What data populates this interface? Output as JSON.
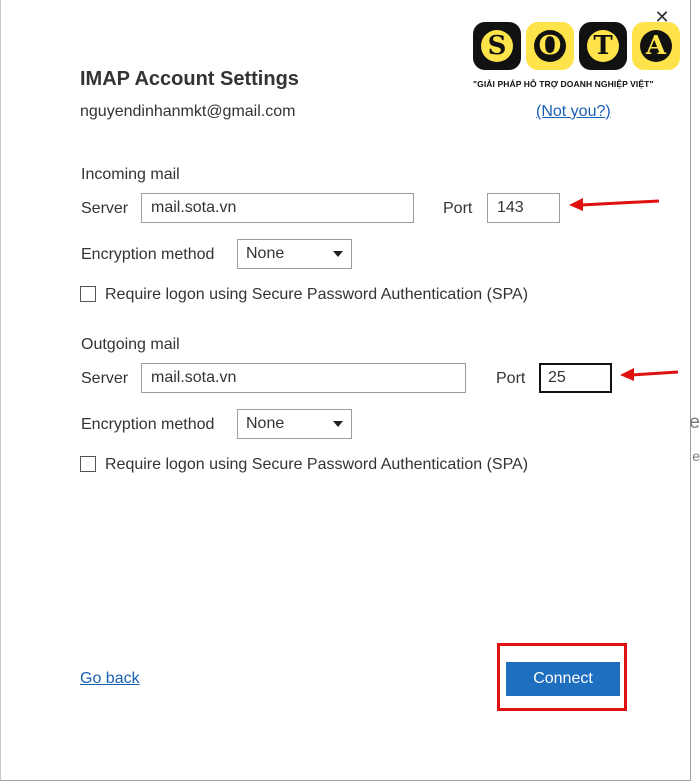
{
  "dialog": {
    "title": "IMAP Account Settings",
    "email": "nguyendinhanmkt@gmail.com",
    "not_you_link": "(Not you?)",
    "close_glyph": "✕"
  },
  "logo": {
    "letters": [
      "S",
      "O",
      "T",
      "A"
    ],
    "tagline": "\"GIẢI PHÁP HỖ TRỢ DOANH NGHIỆP VIỆT\""
  },
  "incoming": {
    "section_label": "Incoming mail",
    "server_label": "Server",
    "server_value": "mail.sota.vn",
    "port_label": "Port",
    "port_value": "143",
    "encryption_label": "Encryption method",
    "encryption_value": "None",
    "spa_label": "Require logon using Secure Password Authentication (SPA)",
    "spa_checked": false
  },
  "outgoing": {
    "section_label": "Outgoing mail",
    "server_label": "Server",
    "server_value": "mail.sota.vn",
    "port_label": "Port",
    "port_value": "25",
    "encryption_label": "Encryption method",
    "encryption_value": "None",
    "spa_label": "Require logon using Secure Password Authentication (SPA)",
    "spa_checked": false
  },
  "footer": {
    "go_back_label": "Go back",
    "connect_label": "Connect"
  },
  "background_peek": [
    "e",
    "e"
  ],
  "colors": {
    "accent_button": "#1e6fc0",
    "link": "#1a5fb4",
    "annotation_red": "#e01010",
    "logo_yellow": "#ffe34a"
  }
}
